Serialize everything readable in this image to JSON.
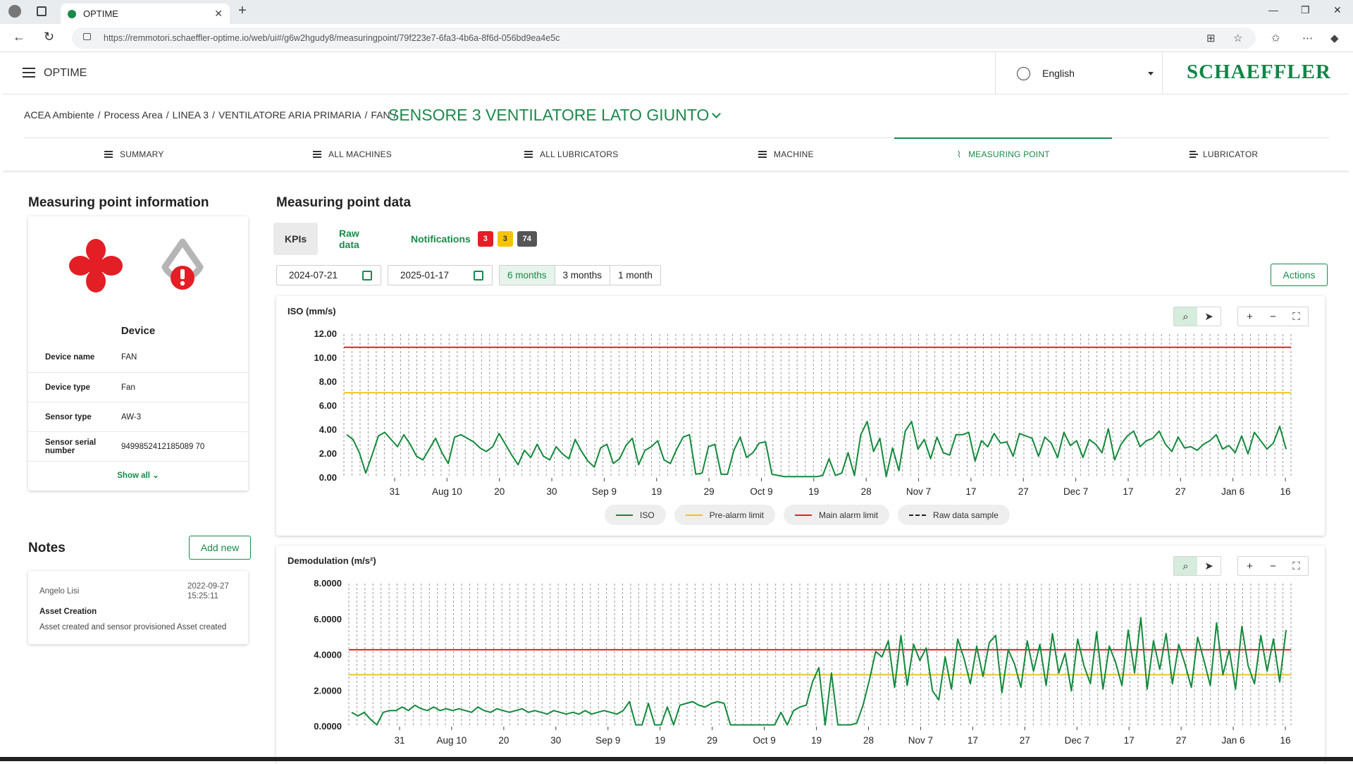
{
  "browser": {
    "tab_title": "OPTIME",
    "url_host": "https://remmotori.schaeffler-optime.io",
    "url_path": "/web/ui#/g6w2hgudy8/measuringpoint/79f223e7-6fa3-4b6a-8f6d-056bd9ea4e5c"
  },
  "header": {
    "app_name": "OPTIME",
    "language": "English",
    "logo_text": "SCHAEFFLER"
  },
  "breadcrumb": {
    "items": [
      "ACEA Ambiente",
      "Process Area",
      "LINEA 3",
      "VENTILATORE ARIA PRIMARIA",
      "FAN"
    ],
    "title": "SENSORE 3 VENTILATORE LATO GIUNTO"
  },
  "nav_tabs": [
    {
      "label": "SUMMARY",
      "icon": "dashboard-icon"
    },
    {
      "label": "ALL MACHINES",
      "icon": "list-icon"
    },
    {
      "label": "ALL LUBRICATORS",
      "icon": "list-icon"
    },
    {
      "label": "MACHINE",
      "icon": "machine-icon"
    },
    {
      "label": "MEASURING POINT",
      "icon": "pulse-icon"
    },
    {
      "label": "LUBRICATOR",
      "icon": "lubricator-icon"
    }
  ],
  "info": {
    "heading": "Measuring point information",
    "device_heading": "Device",
    "rows": [
      {
        "label": "Device name",
        "value": "FAN"
      },
      {
        "label": "Device type",
        "value": "Fan"
      },
      {
        "label": "Sensor type",
        "value": "AW-3"
      },
      {
        "label": "Sensor serial number",
        "value": "9499852412185089 70"
      }
    ],
    "show_all": "Show all",
    "status_color": "#e31e24"
  },
  "notes": {
    "heading": "Notes",
    "add_label": "Add new",
    "items": [
      {
        "author": "Angelo Lisi",
        "date": "2022-09-27",
        "time": "15:25:11",
        "title": "Asset Creation",
        "text": "Asset created and sensor provisioned Asset created"
      }
    ]
  },
  "mp_data": {
    "heading": "Measuring point data",
    "tabs": [
      "KPIs",
      "Raw data",
      "Notifications"
    ],
    "badges": [
      {
        "value": "3",
        "color": "#e31e24"
      },
      {
        "value": "3",
        "color": "#f5c400"
      },
      {
        "value": "74",
        "color": "#555555"
      }
    ],
    "date_from": "2024-07-21",
    "date_to": "2025-01-17",
    "ranges": [
      "6 months",
      "3 months",
      "1 month"
    ],
    "actions_label": "Actions"
  },
  "legend": [
    "ISO",
    "Pre-alarm limit",
    "Main alarm limit",
    "Raw data sample"
  ],
  "colors": {
    "accent": "#1a8a4a",
    "series": "#138a3c",
    "pre_alarm": "#f0c419",
    "main_alarm": "#d9262b"
  },
  "chart_data": [
    {
      "type": "line",
      "title": "ISO (mm/s)",
      "ylim": [
        0,
        12
      ],
      "yticks": [
        "12.00",
        "10.00",
        "8.00",
        "6.00",
        "4.00",
        "2.00",
        "0.00"
      ],
      "xticks": [
        "31",
        "Aug 10",
        "20",
        "30",
        "Sep 9",
        "19",
        "29",
        "Oct 9",
        "19",
        "28",
        "Nov 7",
        "17",
        "27",
        "Dec 7",
        "17",
        "27",
        "Jan 6",
        "16"
      ],
      "pre_alarm": 7.1,
      "main_alarm": 10.9,
      "series": [
        {
          "name": "ISO",
          "values": [
            3.6,
            3.2,
            2.1,
            0.4,
            1.9,
            3.5,
            3.8,
            3.2,
            2.6,
            3.6,
            2.8,
            1.8,
            1.5,
            2.4,
            3.3,
            2.1,
            1.2,
            3.4,
            3.6,
            3.3,
            3.0,
            2.5,
            2.2,
            2.6,
            3.7,
            2.8,
            1.9,
            1.1,
            2.3,
            1.7,
            2.8,
            1.8,
            1.5,
            2.6,
            2.0,
            1.6,
            3.2,
            2.2,
            1.4,
            0.9,
            2.5,
            2.8,
            1.2,
            1.6,
            2.7,
            3.3,
            1.1,
            2.3,
            2.6,
            3.1,
            1.5,
            1.2,
            2.4,
            3.4,
            3.6,
            0.3,
            0.4,
            2.6,
            2.8,
            0.3,
            0.3,
            2.3,
            3.4,
            1.7,
            2.1,
            2.9,
            3.0,
            0.3,
            0.2,
            0.1,
            0.1,
            0.1,
            0.1,
            0.1,
            0.1,
            0.2,
            1.6,
            0.2,
            0.4,
            2.1,
            0.2,
            3.6,
            4.7,
            2.2,
            3.3,
            0.1,
            2.5,
            0.6,
            3.9,
            4.7,
            2.4,
            3.2,
            1.6,
            3.4,
            2.1,
            1.9,
            3.6,
            3.6,
            3.8,
            1.4,
            3.1,
            2.6,
            3.7,
            2.9,
            3.0,
            1.8,
            3.7,
            3.5,
            3.3,
            1.8,
            3.4,
            2.9,
            1.7,
            3.8,
            2.7,
            3.1,
            1.7,
            3.2,
            2.8,
            2.1,
            4.1,
            1.5,
            2.8,
            3.5,
            3.9,
            2.6,
            3.1,
            3.3,
            3.9,
            2.8,
            2.2,
            3.4,
            2.5,
            2.6,
            2.3,
            2.8,
            3.1,
            3.6,
            2.4,
            2.7,
            2.1,
            3.5,
            2.0,
            3.8,
            3.1,
            2.4,
            2.9,
            4.3,
            2.4
          ]
        }
      ]
    },
    {
      "type": "line",
      "title": "Demodulation (m/s²)",
      "ylim": [
        0,
        8
      ],
      "yticks": [
        "8.0000",
        "6.0000",
        "4.0000",
        "2.0000",
        "0.0000"
      ],
      "xticks": [
        "31",
        "Aug 10",
        "20",
        "30",
        "Sep 9",
        "19",
        "29",
        "Oct 9",
        "19",
        "28",
        "Nov 7",
        "17",
        "27",
        "Dec 7",
        "17",
        "27",
        "Jan 6",
        "16"
      ],
      "pre_alarm": 2.9,
      "main_alarm": 4.3,
      "series": [
        {
          "name": "Demodulation",
          "values": [
            0.8,
            0.6,
            0.8,
            0.4,
            0.1,
            0.8,
            0.9,
            0.9,
            1.1,
            0.9,
            1.2,
            1.0,
            0.9,
            1.1,
            0.9,
            1.0,
            0.9,
            1.0,
            0.9,
            0.8,
            1.1,
            0.9,
            0.8,
            1.0,
            0.9,
            0.8,
            0.9,
            1.0,
            0.8,
            0.9,
            0.8,
            0.7,
            0.9,
            0.8,
            0.7,
            0.8,
            0.7,
            0.9,
            0.7,
            0.8,
            0.9,
            0.8,
            0.7,
            0.9,
            1.4,
            0.1,
            0.1,
            1.3,
            0.1,
            0.1,
            1.1,
            0.1,
            1.2,
            1.3,
            1.4,
            1.2,
            1.1,
            1.3,
            1.4,
            1.3,
            0.1,
            0.1,
            0.1,
            0.1,
            0.1,
            0.1,
            0.1,
            0.1,
            0.8,
            0.1,
            0.9,
            1.1,
            1.2,
            2.5,
            3.3,
            0.1,
            3.0,
            0.1,
            0.1,
            0.1,
            0.2,
            1.2,
            2.6,
            4.2,
            3.9,
            4.8,
            2.2,
            5.1,
            2.3,
            4.6,
            3.7,
            4.4,
            2.0,
            1.5,
            3.9,
            2.1,
            4.9,
            3.8,
            2.4,
            4.5,
            2.8,
            4.7,
            5.1,
            1.9,
            4.3,
            3.5,
            2.2,
            4.8,
            3.1,
            4.6,
            2.3,
            5.2,
            3.0,
            4.1,
            2.0,
            4.9,
            3.4,
            2.4,
            5.3,
            2.1,
            4.5,
            3.6,
            2.3,
            5.4,
            3.0,
            6.1,
            2.1,
            4.8,
            3.2,
            5.2,
            2.4,
            4.6,
            3.5,
            2.2,
            5.0,
            3.7,
            2.3,
            5.8,
            2.9,
            4.3,
            2.1,
            5.6,
            3.4,
            2.4,
            5.1,
            3.1,
            4.9,
            2.5,
            5.4
          ]
        }
      ]
    }
  ]
}
